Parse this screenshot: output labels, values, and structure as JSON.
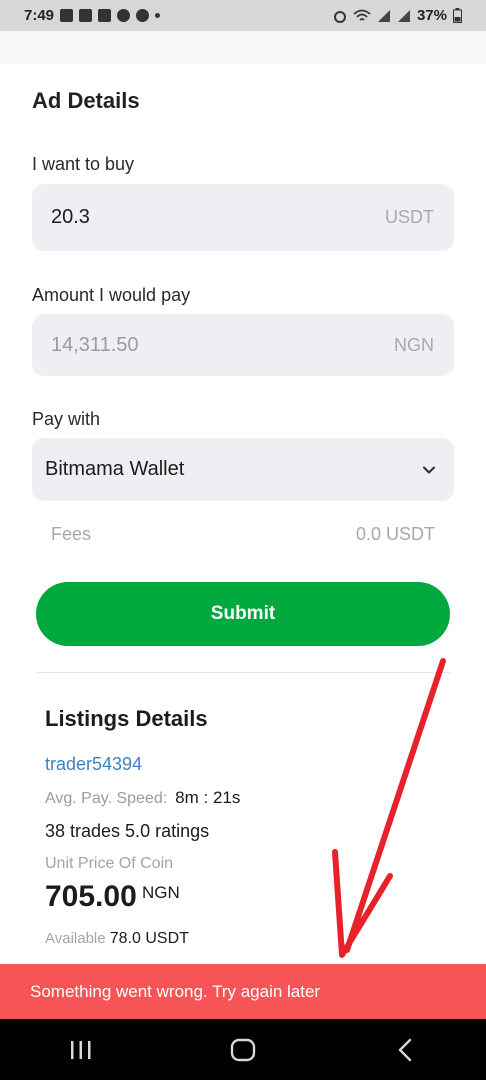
{
  "status_bar": {
    "time": "7:49",
    "battery": "37%"
  },
  "form": {
    "heading": "Ad Details",
    "buy_label": "I want to buy",
    "buy_value": "20.3",
    "buy_unit": "USDT",
    "pay_amount_label": "Amount I would pay",
    "pay_amount_value": "14,311.50",
    "pay_amount_unit": "NGN",
    "pay_with_label": "Pay with",
    "pay_with_value": "Bitmama Wallet",
    "fees_label": "Fees",
    "fees_value": "0.0 USDT",
    "submit_label": "Submit"
  },
  "listing": {
    "title": "Listings Details",
    "trader": "trader54394",
    "speed_label": "Avg. Pay. Speed:",
    "speed_value": "8m : 21s",
    "trades": "38 trades 5.0 ratings",
    "unit_price_label": "Unit Price Of Coin",
    "price": "705.00",
    "price_currency": "NGN",
    "available_label": "Available",
    "available_value": "78.0 USDT"
  },
  "toast": {
    "message": "Something went wrong. Try again later"
  },
  "colors": {
    "accent": "#00a93e",
    "error": "#f65457",
    "link": "#3a83c4",
    "annotation": "#e8222b"
  },
  "icons": [
    "recent-apps-icon",
    "home-icon",
    "back-icon",
    "chevron-down-icon",
    "wifi-icon",
    "signal-icon",
    "battery-icon",
    "alarm-icon"
  ]
}
